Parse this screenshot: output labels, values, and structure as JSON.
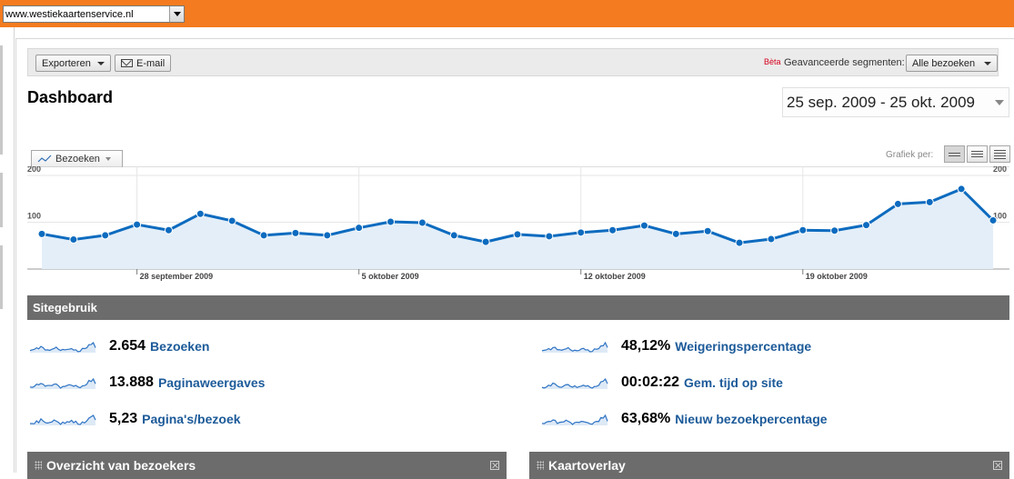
{
  "site_selector": {
    "value": "www.westiekaartenservice.nl"
  },
  "toolbar": {
    "export_label": "Exporteren",
    "email_label": "E-mail",
    "beta_label": "Bèta",
    "segments_label": "Geavanceerde segmenten:",
    "segments_value": "Alle bezoeken"
  },
  "page": {
    "title": "Dashboard"
  },
  "date_range": {
    "value": "25 sep. 2009 - 25 okt. 2009"
  },
  "graph": {
    "metric_label": "Bezoeken",
    "graph_per_label": "Grafiek per:"
  },
  "chart_data": {
    "type": "area",
    "title": "",
    "series": [
      {
        "name": "Bezoeken",
        "values": [
          75,
          63,
          72,
          95,
          83,
          118,
          103,
          72,
          77,
          72,
          88,
          101,
          99,
          72,
          58,
          74,
          70,
          78,
          83,
          93,
          75,
          81,
          56,
          64,
          83,
          82,
          94,
          139,
          143,
          171,
          104
        ]
      }
    ],
    "x_labels": [
      {
        "index": 3,
        "label": "28 september 2009"
      },
      {
        "index": 10,
        "label": "5 oktober 2009"
      },
      {
        "index": 17,
        "label": "12 oktober 2009"
      },
      {
        "index": 24,
        "label": "19 oktober 2009"
      }
    ],
    "y_ticks": [
      100,
      200
    ],
    "ylim": [
      0,
      200
    ],
    "grid": true,
    "color": "#0d6bbf",
    "fill": "#e3eef8"
  },
  "site_usage": {
    "title": "Sitegebruik",
    "left": [
      {
        "value": "2.654",
        "label": "Bezoeken"
      },
      {
        "value": "13.888",
        "label": "Paginaweergaves"
      },
      {
        "value": "5,23",
        "label": "Pagina's/bezoek"
      }
    ],
    "right": [
      {
        "value": "48,12%",
        "label": "Weigeringspercentage"
      },
      {
        "value": "00:02:22",
        "label": "Gem. tijd op site"
      },
      {
        "value": "63,68%",
        "label": "Nieuw bezoekpercentage"
      }
    ]
  },
  "widgets": [
    {
      "title": "Overzicht van bezoekers"
    },
    {
      "title": "Kaartoverlay"
    }
  ]
}
